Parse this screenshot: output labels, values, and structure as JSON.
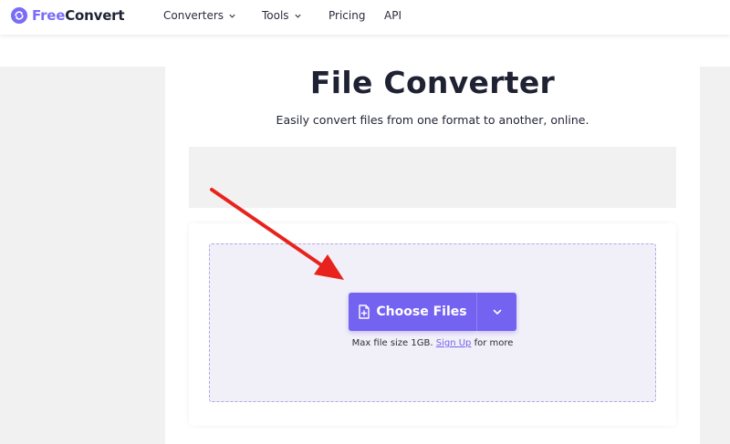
{
  "header": {
    "logo": {
      "part1": "Free",
      "part2": "Convert",
      "icon": "sync-arrows-icon"
    },
    "nav": [
      {
        "label": "Converters",
        "has_dropdown": true
      },
      {
        "label": "Tools",
        "has_dropdown": true
      },
      {
        "label": "Pricing",
        "has_dropdown": false
      },
      {
        "label": "API",
        "has_dropdown": false
      }
    ]
  },
  "main": {
    "title": "File Converter",
    "subtitle": "Easily convert files from one format to another, online."
  },
  "upload": {
    "choose_label": "Choose Files",
    "choose_icon": "file-plus-icon",
    "dropdown_icon": "chevron-down-icon",
    "note_prefix": "Max file size 1GB.",
    "note_link": "Sign Up",
    "note_suffix": "for more"
  },
  "colors": {
    "brand": "#7b6cf6",
    "button": "#7462f1",
    "dropzone_bg": "#f1eff7",
    "dropzone_border": "#b3a8e6",
    "annotation_arrow": "#e8231d"
  }
}
